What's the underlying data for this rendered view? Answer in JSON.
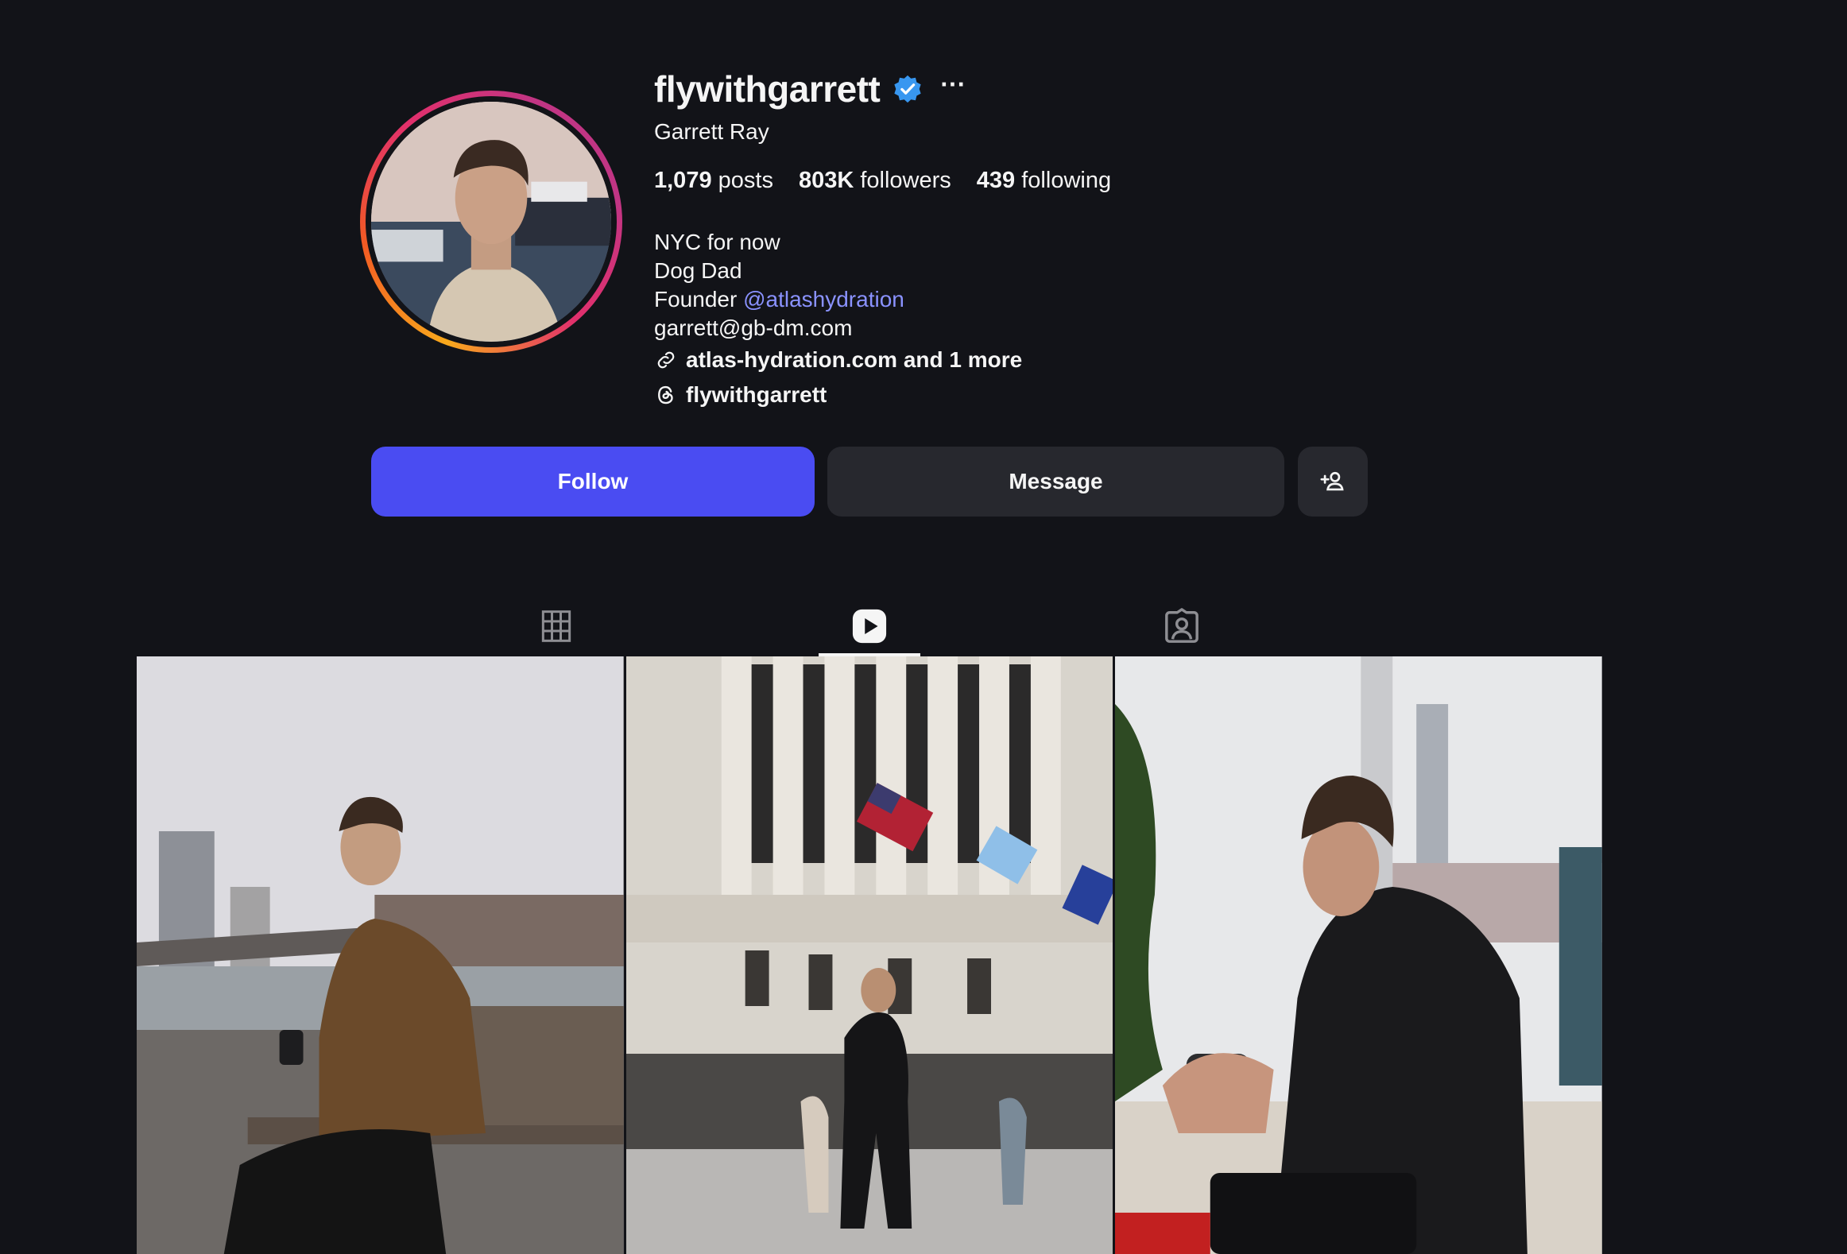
{
  "profile": {
    "username": "flywithgarrett",
    "more_label": "···",
    "full_name": "Garrett Ray",
    "stats": {
      "posts": "1,079",
      "posts_label": "posts",
      "followers": "803K",
      "followers_label": "followers",
      "following": "439",
      "following_label": "following"
    },
    "bio": {
      "line1": "NYC for now",
      "line2": "Dog Dad",
      "line3_prefix": "Founder ",
      "mention": "@atlashydration",
      "email": "garrett@gb-dm.com"
    },
    "link_text": "atlas-hydration.com and 1 more",
    "threads_handle": "flywithgarrett"
  },
  "actions": {
    "follow_label": "Follow",
    "message_label": "Message"
  },
  "tabs": [
    {
      "name": "posts",
      "icon": "grid-icon",
      "active": false
    },
    {
      "name": "reels",
      "icon": "reels-icon",
      "active": true
    },
    {
      "name": "tagged",
      "icon": "tagged-icon",
      "active": false
    }
  ],
  "colors": {
    "background": "#121318",
    "follow": "#4a4cf2",
    "secondary_button": "#27282e",
    "mention": "#8a92ff",
    "verified": "#3897f0"
  },
  "grid": [
    {
      "description": "man-on-bench-brooklyn-bridge"
    },
    {
      "description": "man-walking-nyse-flags"
    },
    {
      "description": "man-holding-product-black-sweater"
    }
  ]
}
